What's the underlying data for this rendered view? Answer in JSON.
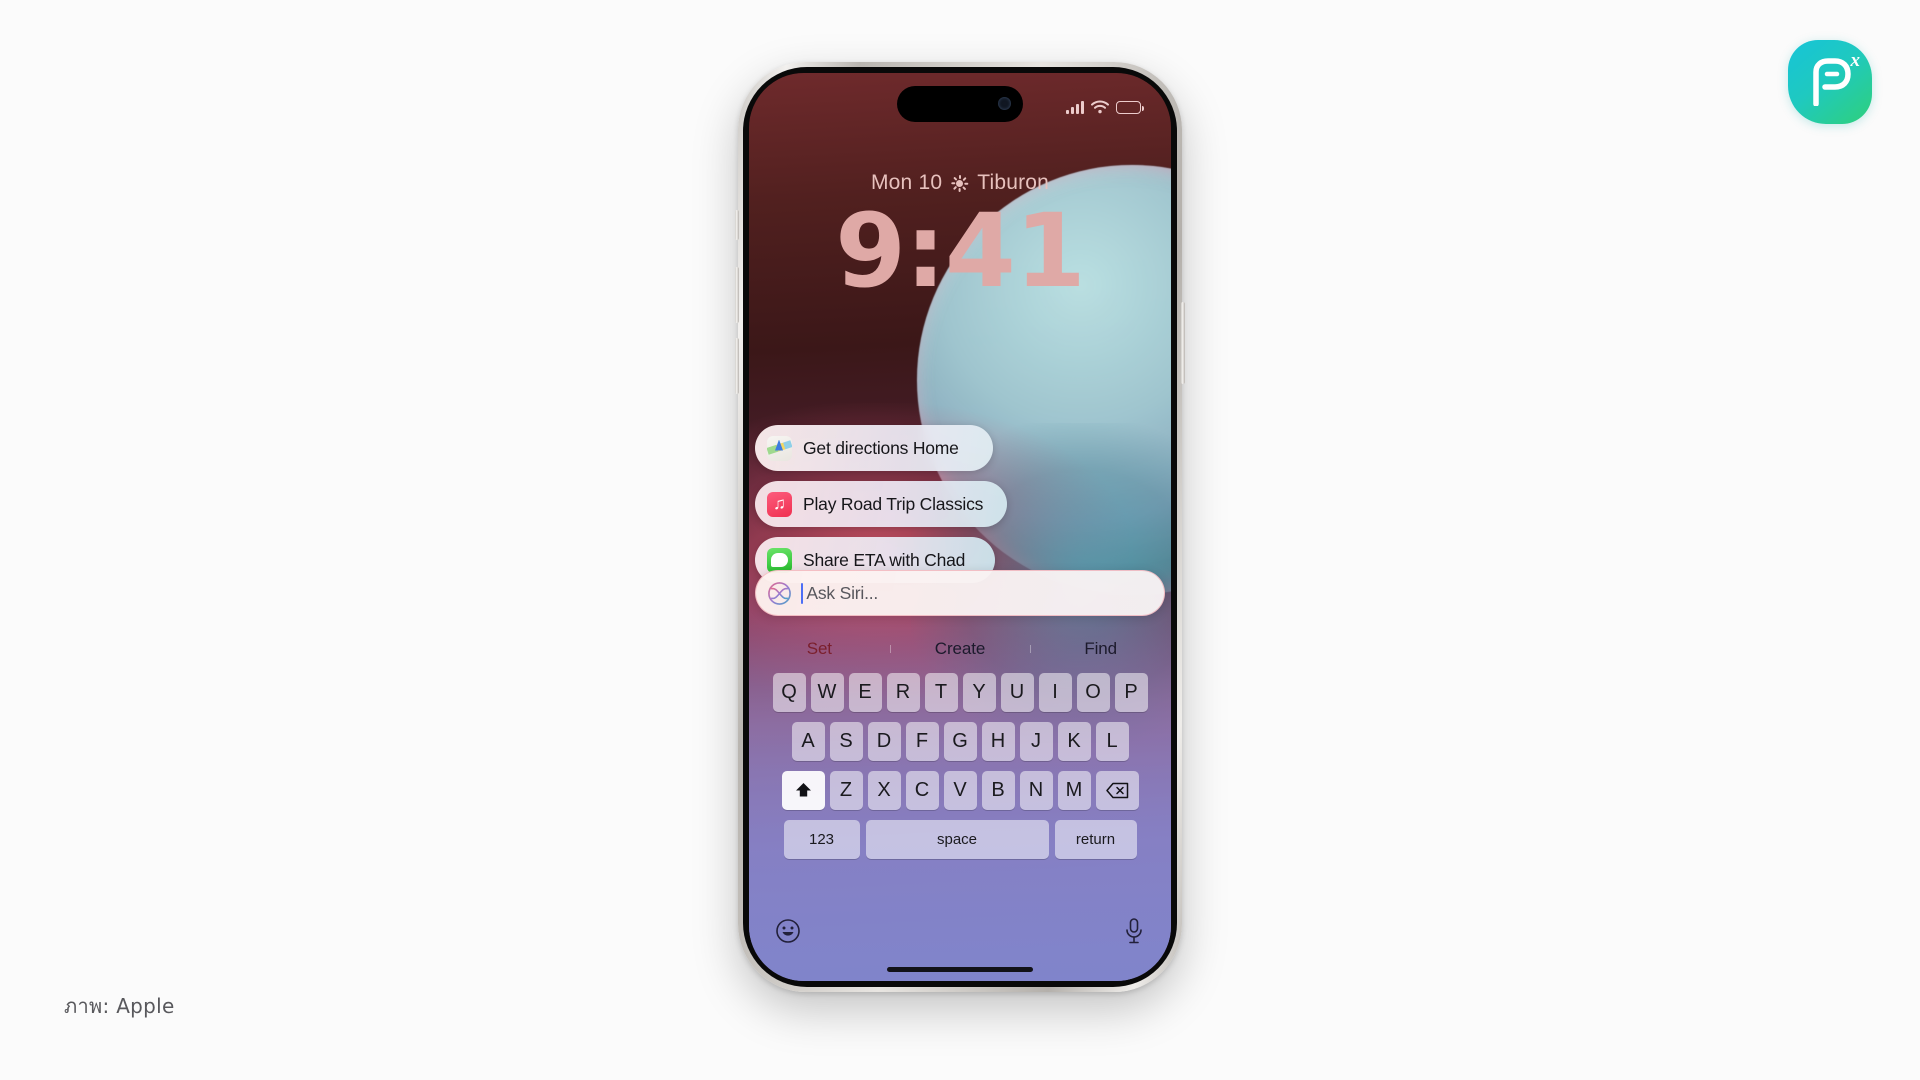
{
  "watermark": {
    "letter": "P",
    "superscript": "x",
    "name": "app-logo"
  },
  "caption": "ภาพ: Apple",
  "phone": {
    "status_bar": {
      "signal_icon": "cellular-signal-icon",
      "wifi_icon": "wifi-icon",
      "battery_icon": "battery-icon"
    },
    "lock_screen": {
      "date": "Mon 10",
      "weather_icon": "sun-icon",
      "location": "Tiburon",
      "time": "9:41"
    },
    "siri_suggestions": [
      {
        "label": "Get directions Home",
        "icon": "maps-app-icon"
      },
      {
        "label": "Play Road Trip Classics",
        "icon": "music-app-icon"
      },
      {
        "label": "Share ETA with Chad",
        "icon": "messages-app-icon"
      }
    ],
    "siri_input": {
      "icon": "siri-orb-icon",
      "placeholder": "Ask Siri...",
      "value": ""
    },
    "predictive_bar": [
      {
        "label": "Set"
      },
      {
        "label": "Create"
      },
      {
        "label": "Find"
      }
    ],
    "keyboard": {
      "row1": [
        "Q",
        "W",
        "E",
        "R",
        "T",
        "Y",
        "U",
        "I",
        "O",
        "P"
      ],
      "row2": [
        "A",
        "S",
        "D",
        "F",
        "G",
        "H",
        "J",
        "K",
        "L"
      ],
      "row3_letters": [
        "Z",
        "X",
        "C",
        "V",
        "B",
        "N",
        "M"
      ],
      "shift_icon": "shift-key-icon",
      "backspace_icon": "backspace-key-icon",
      "numeric_label": "123",
      "space_label": "space",
      "return_label": "return",
      "emoji_icon": "emoji-key-icon",
      "dictation_icon": "microphone-key-icon"
    }
  },
  "colors": {
    "page_background": "#fbfbfb",
    "logo_gradient_start": "#16c4d8",
    "logo_gradient_end": "#2fd07a",
    "clock_text": "#dfa9a6",
    "date_text": "#e7c1bd",
    "predict_accent": "#7b1f2c",
    "caret": "#4d6ef5"
  }
}
